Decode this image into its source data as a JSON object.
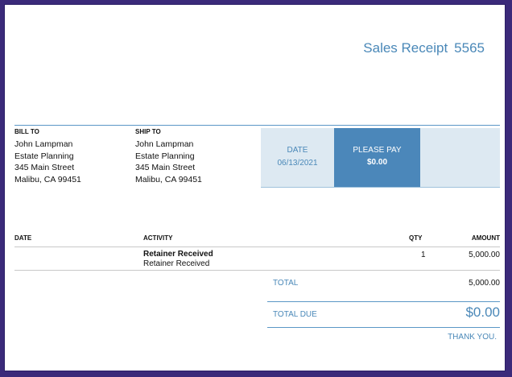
{
  "receipt": {
    "title_label": "Sales Receipt",
    "number": "5565"
  },
  "bill_to": {
    "heading": "BILL TO",
    "name": "John Lampman",
    "company": "Estate Planning",
    "street": "345 Main Street",
    "city": "Malibu, CA  99451"
  },
  "ship_to": {
    "heading": "SHIP TO",
    "name": "John Lampman",
    "company": "Estate Planning",
    "street": "345 Main Street",
    "city": "Malibu, CA  99451"
  },
  "summary": {
    "date_label": "DATE",
    "date_value": "06/13/2021",
    "pay_label": "PLEASE PAY",
    "pay_value": "$0.00"
  },
  "table": {
    "headers": {
      "date": "DATE",
      "activity": "ACTIVITY",
      "qty": "QTY",
      "amount": "AMOUNT"
    },
    "rows": [
      {
        "activity_name": "Retainer Received",
        "activity_desc": "Retainer Received",
        "qty": "1",
        "amount": "5,000.00"
      }
    ]
  },
  "totals": {
    "total_label": "TOTAL",
    "total_value": "5,000.00",
    "due_label": "TOTAL DUE",
    "due_value": "$0.00",
    "thanks": "THANK YOU."
  },
  "colors": {
    "accent": "#4a88b8",
    "pay_box": "#4b87ba",
    "summary_bg": "#dde9f2",
    "frame": "#3b2a7a"
  }
}
